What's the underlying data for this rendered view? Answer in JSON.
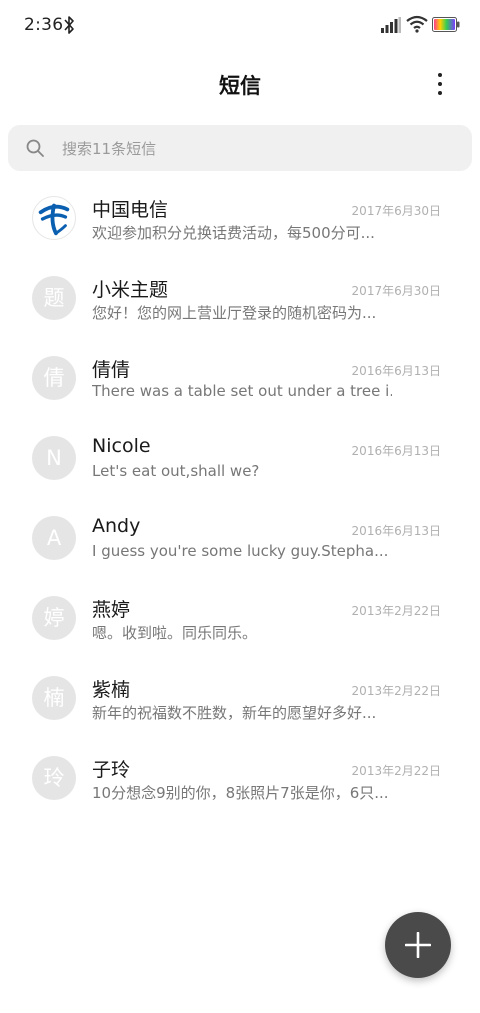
{
  "status_bar": {
    "time": "2:36"
  },
  "header": {
    "title": "短信"
  },
  "search": {
    "placeholder": "搜索11条短信"
  },
  "messages": [
    {
      "avatar": "",
      "avatar_type": "logo",
      "name": "中国电信",
      "date": "2017年6月30日",
      "preview": "欢迎参加积分兑换话费活动，每500分可..."
    },
    {
      "avatar": "题",
      "name": "小米主题",
      "date": "2017年6月30日",
      "preview": "您好！您的网上营业厅登录的随机密码为..."
    },
    {
      "avatar": "倩",
      "name": "倩倩",
      "date": "2016年6月13日",
      "preview": "There was a table set out under a tree i..."
    },
    {
      "avatar": "N",
      "name": "Nicole",
      "date": "2016年6月13日",
      "preview": "Let's eat out,shall we?"
    },
    {
      "avatar": "A",
      "name": "Andy",
      "date": "2016年6月13日",
      "preview": "I guess you're some lucky guy.Stepha..."
    },
    {
      "avatar": "婷",
      "name": "燕婷",
      "date": "2013年2月22日",
      "preview": "嗯。收到啦。同乐同乐。"
    },
    {
      "avatar": "楠",
      "name": "紫楠",
      "date": "2013年2月22日",
      "preview": "新年的祝福数不胜数，新年的愿望好多好..."
    },
    {
      "avatar": "玲",
      "name": "子玲",
      "date": "2013年2月22日",
      "preview": "10分想念9别的你，8张照片7张是你，6只..."
    }
  ],
  "colors": {
    "fab": "#4a4a4a",
    "avatar_bg": "#e5e5e5",
    "logo_blue": "#0b5fb0"
  },
  "icons": [
    "bluetooth-icon",
    "signal-icon",
    "wifi-icon",
    "battery-icon",
    "more-vertical-icon",
    "search-icon",
    "telecom-logo",
    "plus-icon"
  ]
}
